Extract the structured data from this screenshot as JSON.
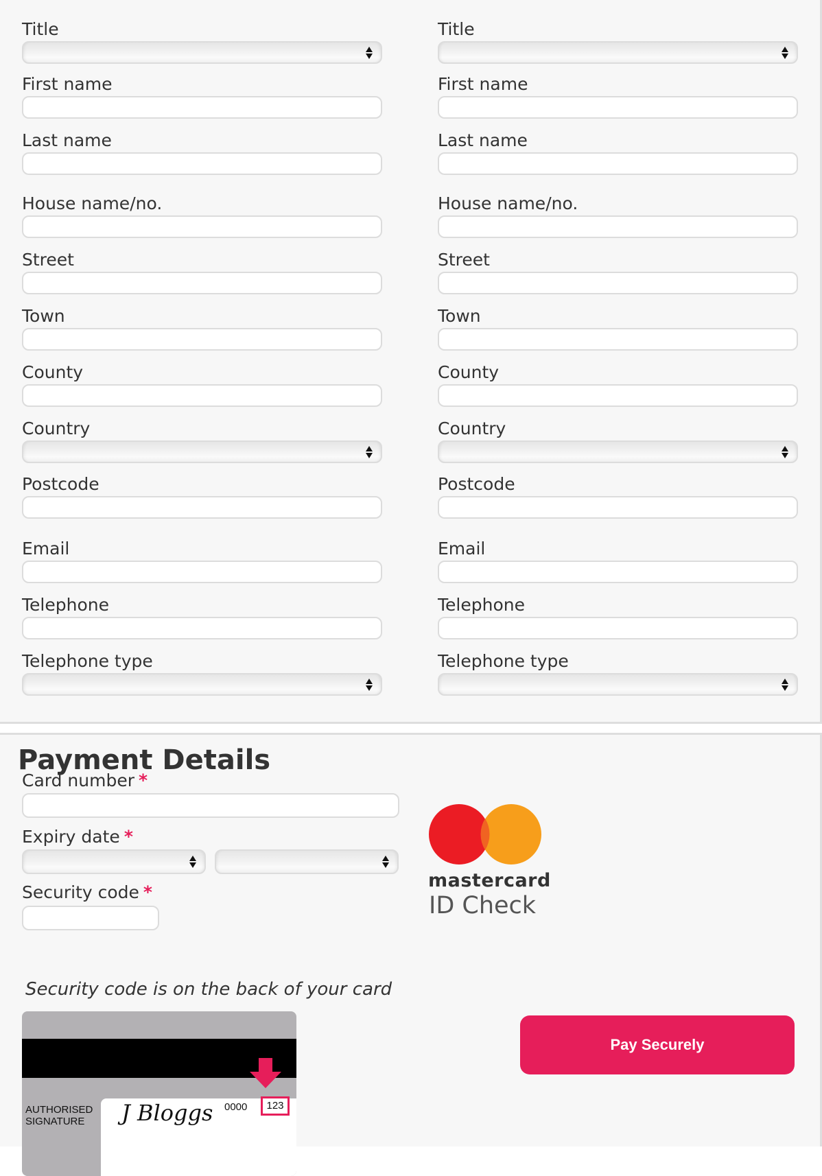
{
  "address_columns": [
    {
      "fields": [
        {
          "label": "Title",
          "type": "select",
          "value": ""
        },
        {
          "label": "First name",
          "type": "text",
          "value": ""
        },
        {
          "label": "Last name",
          "type": "text",
          "value": ""
        },
        {
          "label": "House name/no.",
          "type": "text",
          "value": ""
        },
        {
          "label": "Street",
          "type": "text",
          "value": ""
        },
        {
          "label": "Town",
          "type": "text",
          "value": ""
        },
        {
          "label": "County",
          "type": "text",
          "value": ""
        },
        {
          "label": "Country",
          "type": "select",
          "value": ""
        },
        {
          "label": "Postcode",
          "type": "text",
          "value": ""
        },
        {
          "label": "Email",
          "type": "text",
          "value": ""
        },
        {
          "label": "Telephone",
          "type": "text",
          "value": ""
        },
        {
          "label": "Telephone type",
          "type": "select",
          "value": ""
        }
      ]
    },
    {
      "fields": [
        {
          "label": "Title",
          "type": "select",
          "value": ""
        },
        {
          "label": "First name",
          "type": "text",
          "value": ""
        },
        {
          "label": "Last name",
          "type": "text",
          "value": ""
        },
        {
          "label": "House name/no.",
          "type": "text",
          "value": ""
        },
        {
          "label": "Street",
          "type": "text",
          "value": ""
        },
        {
          "label": "Town",
          "type": "text",
          "value": ""
        },
        {
          "label": "County",
          "type": "text",
          "value": ""
        },
        {
          "label": "Country",
          "type": "select",
          "value": ""
        },
        {
          "label": "Postcode",
          "type": "text",
          "value": ""
        },
        {
          "label": "Email",
          "type": "text",
          "value": ""
        },
        {
          "label": "Telephone",
          "type": "text",
          "value": ""
        },
        {
          "label": "Telephone type",
          "type": "select",
          "value": ""
        }
      ]
    }
  ],
  "payment": {
    "title": "Payment Details",
    "required_marker": "*",
    "card_number": {
      "label": "Card number",
      "value": ""
    },
    "expiry_date": {
      "label": "Expiry date",
      "month_value": "",
      "year_value": ""
    },
    "security_code": {
      "label": "Security code",
      "value": ""
    },
    "security_hint": "Security code is on the back of your card",
    "pay_button": "Pay Securely",
    "logo": {
      "wordmark": "mastercard",
      "subtitle": "ID Check",
      "icon": "mastercard-logo-icon"
    },
    "card_illustration": {
      "signature_label_line1": "AUTHORISED",
      "signature_label_line2": "SIGNATURE",
      "signature_name": "J Bloggs",
      "number_tail": "0000",
      "cvv": "123"
    }
  },
  "colors": {
    "accent": "#e61e5a",
    "background": "#f7f7f7",
    "border": "#dedede",
    "text": "#333333",
    "mastercard_red": "#eb1c24",
    "mastercard_orange": "#f79e1b",
    "mastercard_overlap": "#f06322"
  }
}
